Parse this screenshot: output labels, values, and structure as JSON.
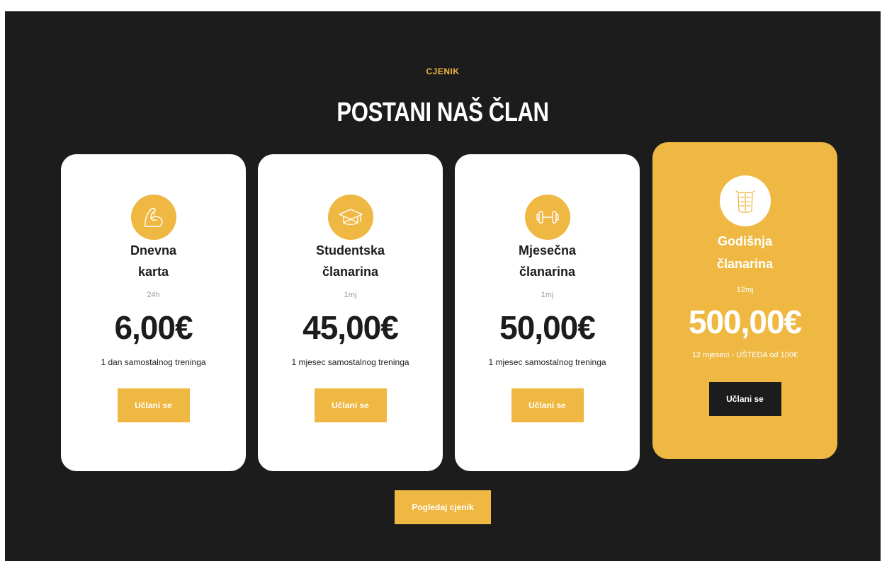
{
  "section": {
    "eyebrow": "CJENIK",
    "title": "POSTANI NAŠ ČLAN"
  },
  "plans": [
    {
      "icon": "flexed-arm-icon",
      "title_line1": "Dnevna",
      "title_line2": "karta",
      "period": "24h",
      "price": "6,00€",
      "description": "1 dan samostalnog treninga",
      "button": "Učlani se"
    },
    {
      "icon": "graduation-cap-icon",
      "title_line1": "Studentska",
      "title_line2": "članarina",
      "period": "1mj",
      "price": "45,00€",
      "description": "1 mjesec samostalnog treninga",
      "button": "Učlani se"
    },
    {
      "icon": "dumbbell-icon",
      "title_line1": "Mjesečna",
      "title_line2": "članarina",
      "period": "1mj",
      "price": "50,00€",
      "description": "1 mjesec samostalnog treninga",
      "button": "Učlani se"
    },
    {
      "icon": "abs-torso-icon",
      "title_line1": "Godišnja",
      "title_line2": "članarina",
      "period": "12mj",
      "price": "500,00€",
      "description": "12 mjeseci - UŠTEDA od 100€",
      "button": "Učlani se"
    }
  ],
  "footer_button": "Pogledaj cjenik",
  "colors": {
    "background": "#1c1c1c",
    "accent": "#efb843",
    "card": "#ffffff",
    "text_dark": "#1c1c1c"
  }
}
